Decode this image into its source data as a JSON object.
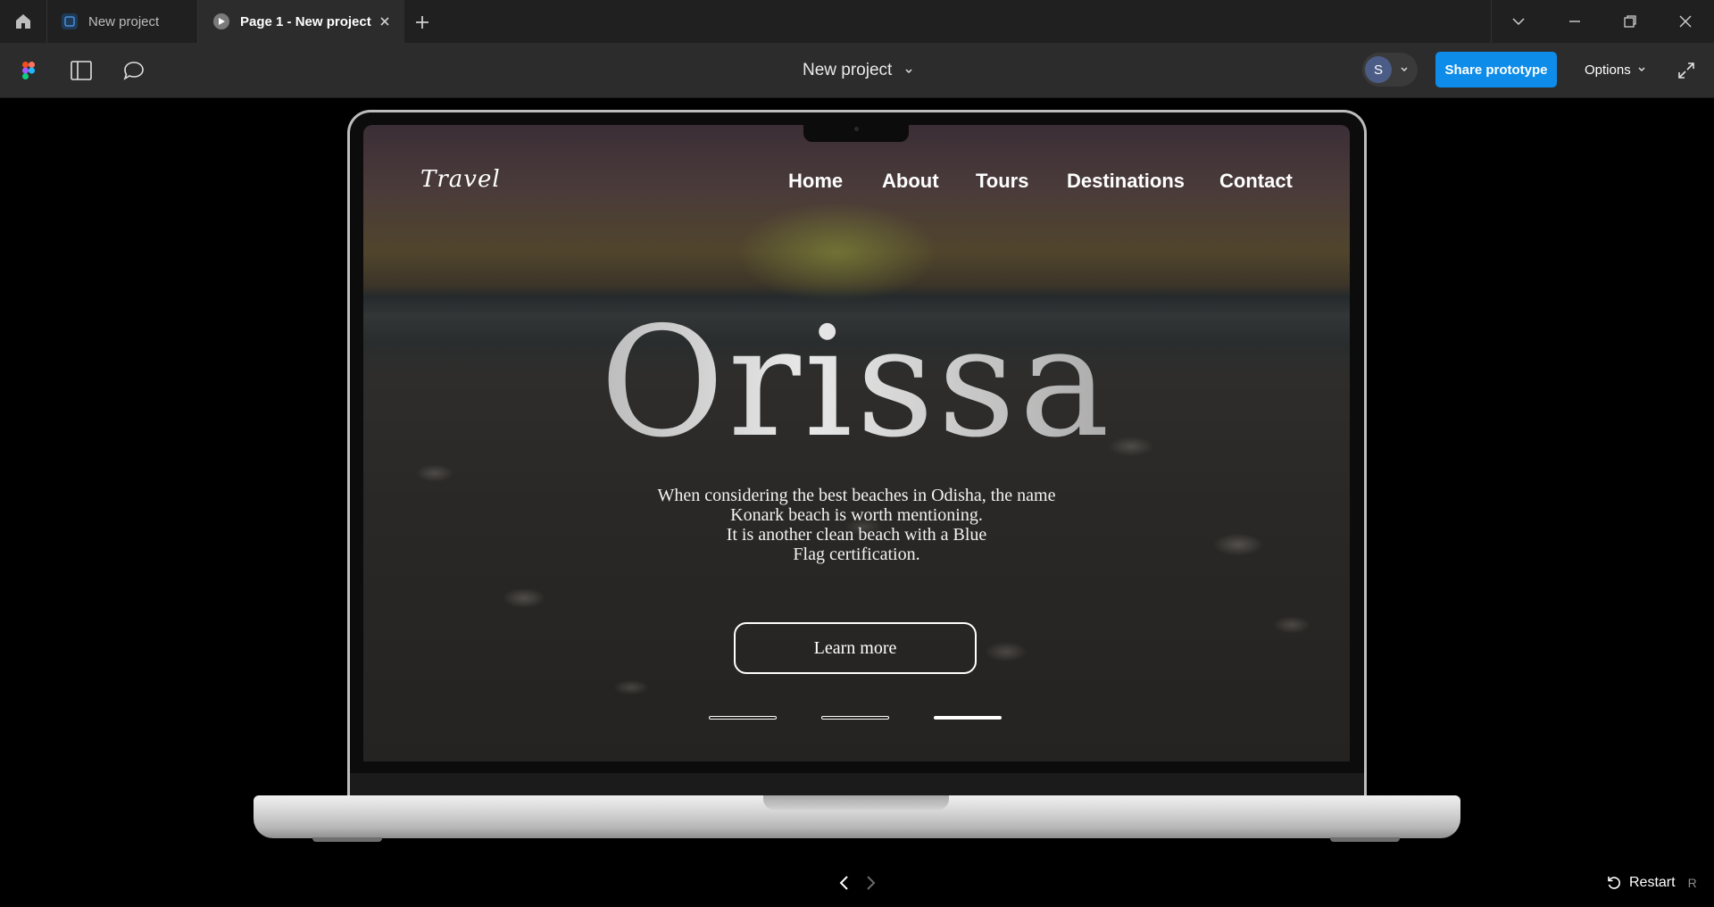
{
  "tabs": [
    {
      "label": "New project",
      "active": false
    },
    {
      "label": "Page 1 - New project",
      "active": true
    }
  ],
  "toolbar": {
    "project_title": "New project",
    "avatar_initial": "S",
    "share_label": "Share prototype",
    "options_label": "Options"
  },
  "site": {
    "logo": "Travel",
    "nav": [
      "Home",
      "About",
      "Tours",
      "Destinations",
      "Contact"
    ],
    "hero_title": "Orissa",
    "hero_lines": [
      "When considering the best beaches in Odisha, the name",
      "Konark beach is worth mentioning.",
      "It is another clean beach with a Blue",
      "Flag certification."
    ],
    "cta_label": "Learn more",
    "slides": {
      "count": 3,
      "active_index": 2
    }
  },
  "footer": {
    "restart_label": "Restart",
    "restart_shortcut": "R"
  },
  "colors": {
    "share_button": "#0d8ce9",
    "toolbar_bg": "#2c2c2c",
    "tabbar_bg": "#202020"
  }
}
